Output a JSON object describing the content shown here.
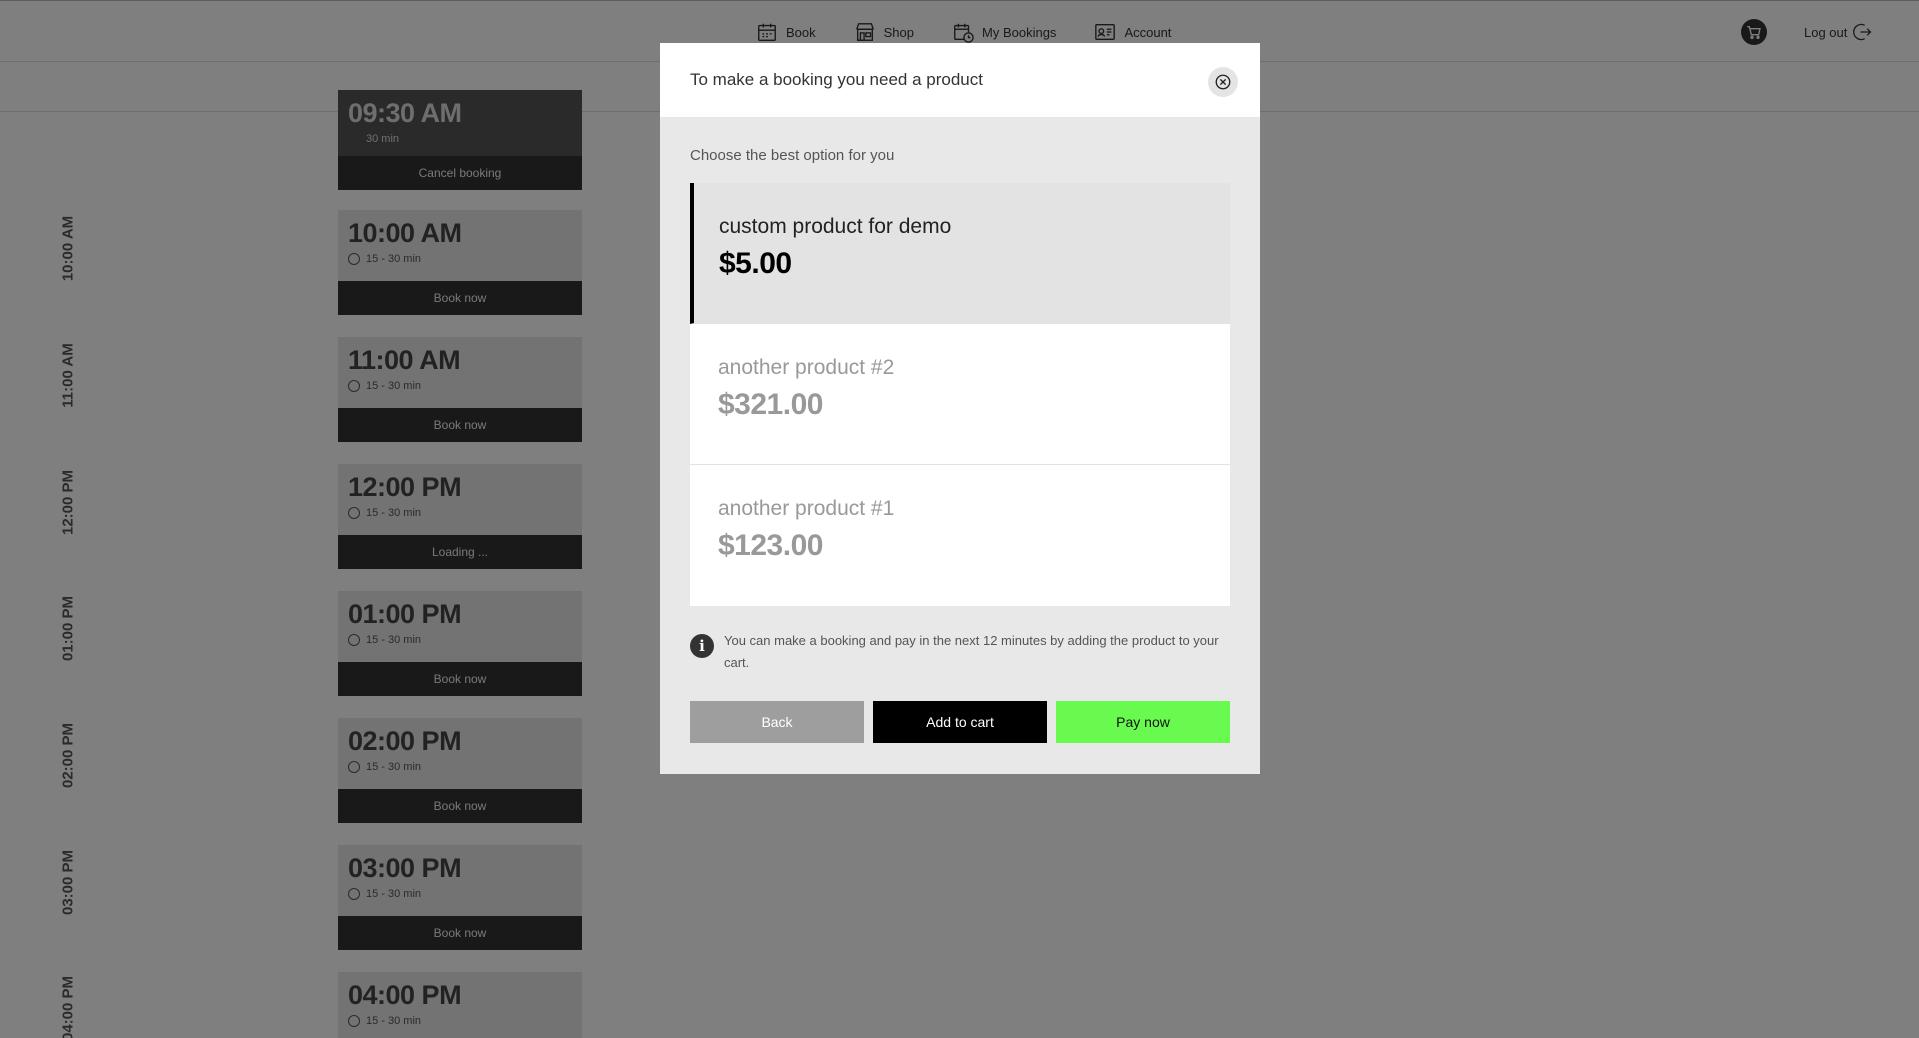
{
  "nav": {
    "items": [
      {
        "label": "Book",
        "icon": "calendar-icon"
      },
      {
        "label": "Shop",
        "icon": "store-icon"
      },
      {
        "label": "My Bookings",
        "icon": "calendar-clock-icon"
      },
      {
        "label": "Account",
        "icon": "id-card-icon"
      }
    ],
    "cart_icon": "cart-icon",
    "logout_label": "Log out"
  },
  "schedule": {
    "axis_labels": [
      "10:00 AM",
      "11:00 AM",
      "12:00 PM",
      "01:00 PM",
      "02:00 PM",
      "03:00 PM",
      "04:00 PM"
    ],
    "booked_slot": {
      "time": "09:30 AM",
      "duration": "30 min",
      "action": "Cancel booking"
    },
    "slots": [
      {
        "time": "10:00 AM",
        "duration": "15 - 30 min",
        "action": "Book now"
      },
      {
        "time": "11:00 AM",
        "duration": "15 - 30 min",
        "action": "Book now"
      },
      {
        "time": "12:00 PM",
        "duration": "15 - 30 min",
        "action": "Loading ..."
      },
      {
        "time": "01:00 PM",
        "duration": "15 - 30 min",
        "action": "Book now"
      },
      {
        "time": "02:00 PM",
        "duration": "15 - 30 min",
        "action": "Book now"
      },
      {
        "time": "03:00 PM",
        "duration": "15 - 30 min",
        "action": "Book now"
      },
      {
        "time": "04:00 PM",
        "duration": "15 - 30 min",
        "action": ""
      }
    ]
  },
  "modal": {
    "title": "To make a booking you need a product",
    "subtitle": "Choose the best option for you",
    "products": [
      {
        "name": "custom product for demo",
        "price": "$5.00",
        "selected": true
      },
      {
        "name": "another product #2",
        "price": "$321.00",
        "selected": false
      },
      {
        "name": "another product #1",
        "price": "$123.00",
        "selected": false
      }
    ],
    "info_text": "You can make a booking and pay in the next 12 minutes by adding the product to your cart.",
    "buttons": {
      "back": "Back",
      "add_to_cart": "Add to cart",
      "pay_now": "Pay now"
    }
  },
  "colors": {
    "accent_pay": "#69fa50",
    "overlay": "rgba(0,0,0,0.5)"
  }
}
